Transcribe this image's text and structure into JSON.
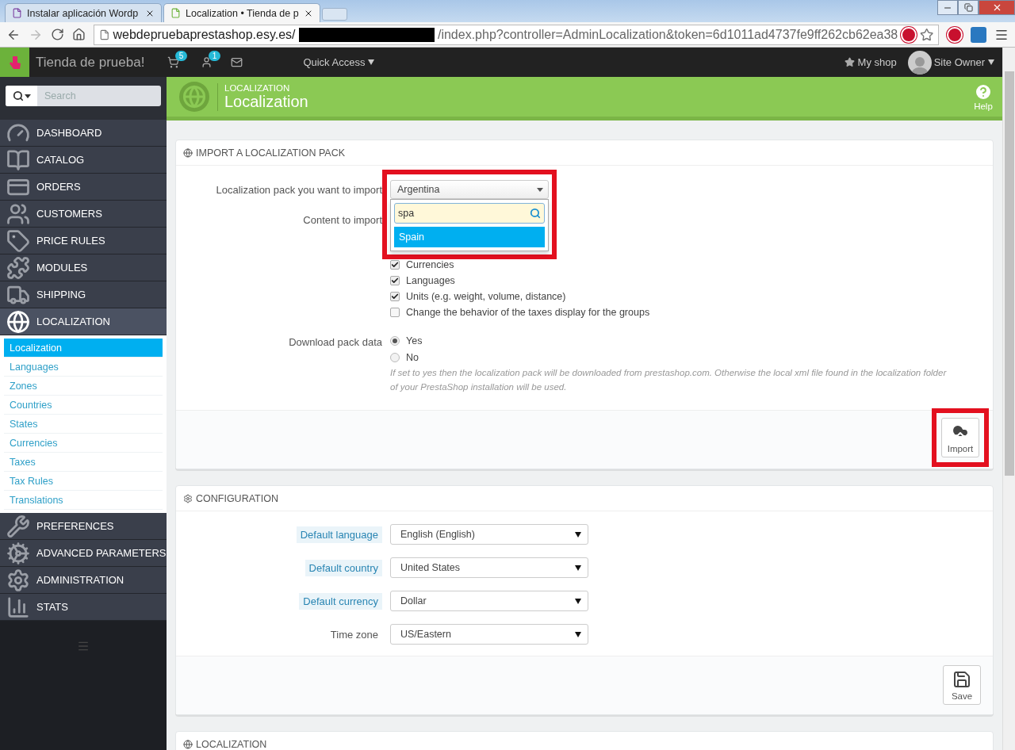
{
  "browser": {
    "tabs": [
      {
        "title": "Instalar aplicación Wordp",
        "selected": false
      },
      {
        "title": "Localization • Tienda de p",
        "selected": true
      }
    ],
    "address": {
      "host": "webdepruebaprestashop.esy.es/",
      "path": "/index.php?controller=AdminLocalization&token=6d1011ad4737fe9ff262cb62ea38"
    }
  },
  "header": {
    "shop_name": "Tienda de prueba!",
    "cart_count": "5",
    "customer_count": "1",
    "quick_access": "Quick Access",
    "my_shop": "My shop",
    "user": "Site Owner"
  },
  "sidebar": {
    "search_placeholder": "Search",
    "items": [
      {
        "label": "DASHBOARD",
        "selected": false
      },
      {
        "label": "CATALOG",
        "selected": false
      },
      {
        "label": "ORDERS",
        "selected": false
      },
      {
        "label": "CUSTOMERS",
        "selected": false
      },
      {
        "label": "PRICE RULES",
        "selected": false
      },
      {
        "label": "MODULES",
        "selected": false
      },
      {
        "label": "SHIPPING",
        "selected": false
      },
      {
        "label": "LOCALIZATION",
        "selected": true,
        "children": [
          {
            "label": "Localization",
            "selected": true
          },
          {
            "label": "Languages",
            "selected": false
          },
          {
            "label": "Zones",
            "selected": false
          },
          {
            "label": "Countries",
            "selected": false
          },
          {
            "label": "States",
            "selected": false
          },
          {
            "label": "Currencies",
            "selected": false
          },
          {
            "label": "Taxes",
            "selected": false
          },
          {
            "label": "Tax Rules",
            "selected": false
          },
          {
            "label": "Translations",
            "selected": false
          }
        ]
      },
      {
        "label": "PREFERENCES",
        "selected": false
      },
      {
        "label": "ADVANCED PARAMETERS",
        "selected": false
      },
      {
        "label": "ADMINISTRATION",
        "selected": false
      },
      {
        "label": "STATS",
        "selected": false
      }
    ]
  },
  "page_header": {
    "breadcrumb": "LOCALIZATION",
    "title": "Localization",
    "help": "Help"
  },
  "import_panel": {
    "title": "IMPORT A LOCALIZATION PACK",
    "pack_label": "Localization pack you want to import",
    "pack_select": {
      "value": "Argentina",
      "expanded": true,
      "search_value": "spa",
      "options": [
        {
          "label": "Spain",
          "selected": true
        }
      ]
    },
    "content_label": "Content to import",
    "checkboxes": [
      {
        "label": "Currencies",
        "checked": true
      },
      {
        "label": "Languages",
        "checked": true
      },
      {
        "label": "Units (e.g. weight, volume, distance)",
        "checked": true
      },
      {
        "label": "Change the behavior of the taxes display for the groups",
        "checked": false
      }
    ],
    "download_label": "Download pack data",
    "radios": [
      {
        "label": "Yes",
        "selected": true
      },
      {
        "label": "No",
        "selected": false
      }
    ],
    "hint": "If set to yes then the localization pack will be downloaded from prestashop.com. Otherwise the local xml file found in the localization folder of your PrestaShop installation will be used.",
    "button": "Import"
  },
  "config_panel": {
    "title": "CONFIGURATION",
    "fields": [
      {
        "label": "Default language",
        "value": "English (English)",
        "hint": true
      },
      {
        "label": "Default country",
        "value": "United States",
        "hint": true
      },
      {
        "label": "Default currency",
        "value": "Dollar",
        "hint": true
      },
      {
        "label": "Time zone",
        "value": "US/Eastern",
        "hint": false
      }
    ],
    "button": "Save"
  },
  "localization_panel": {
    "title": "LOCALIZATION"
  }
}
